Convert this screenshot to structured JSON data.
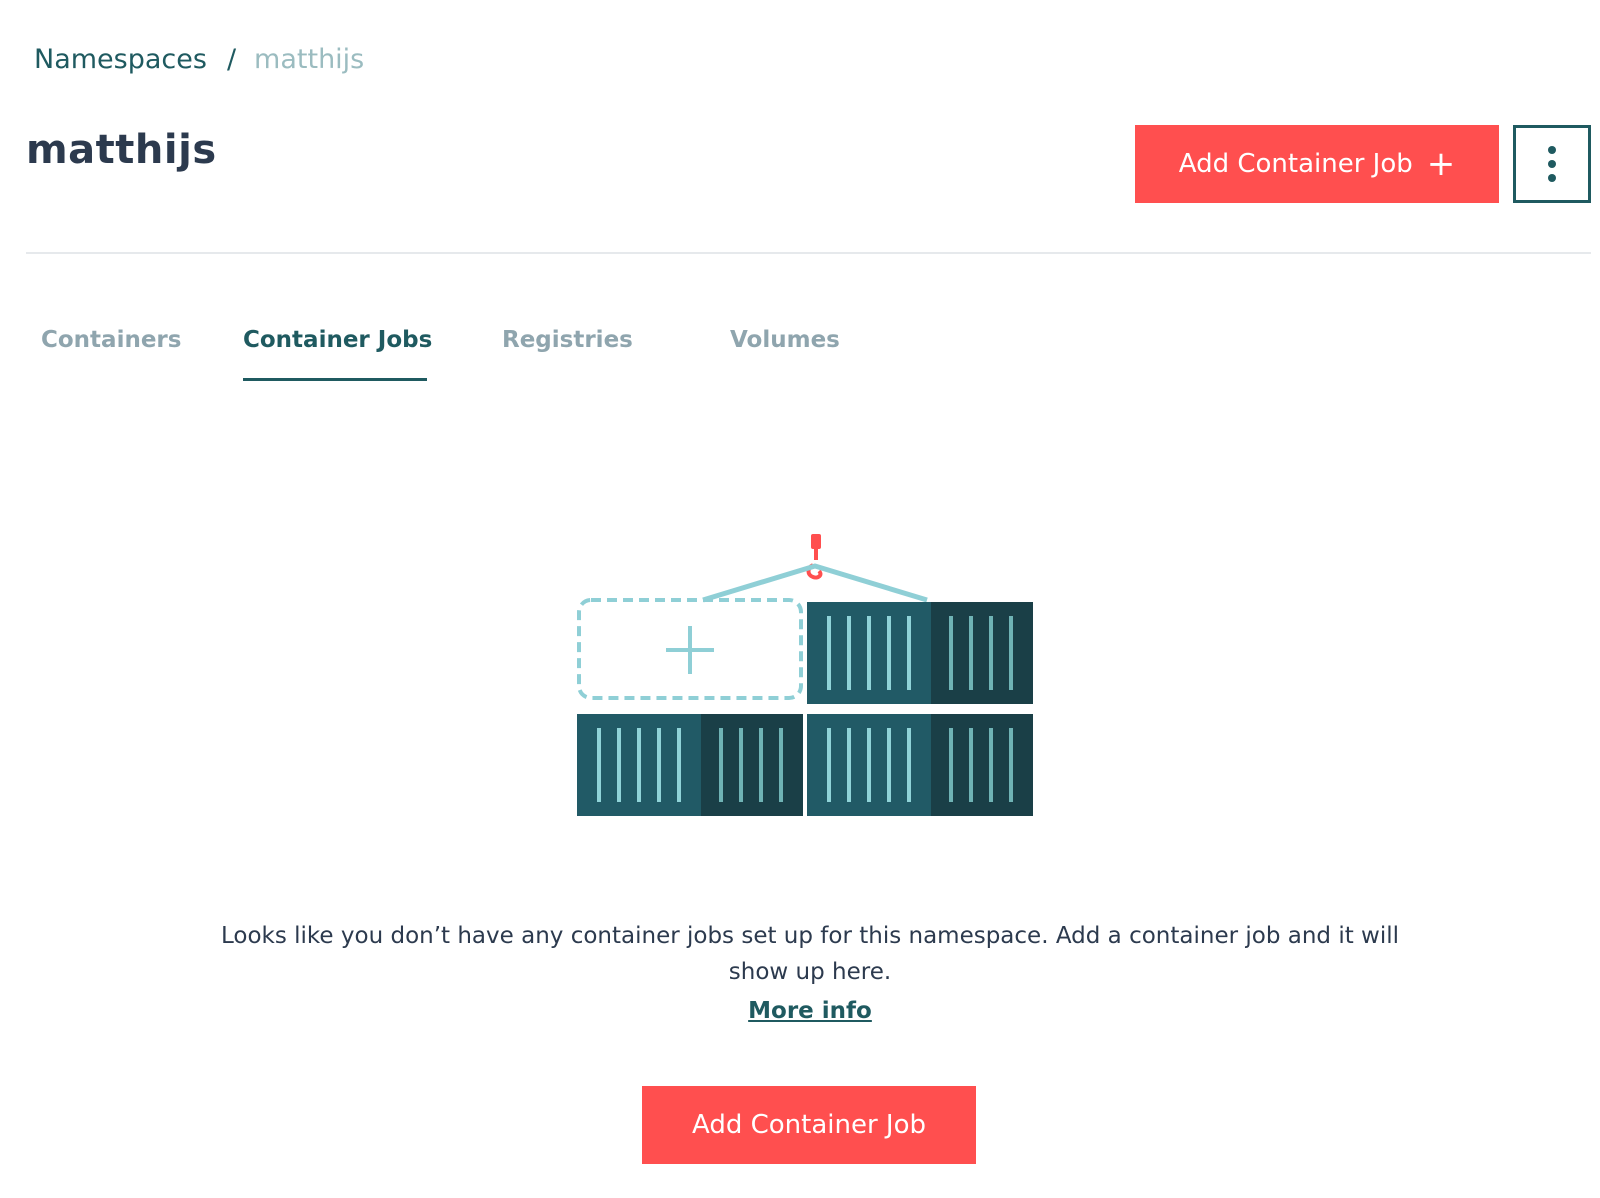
{
  "breadcrumb": {
    "root": "Namespaces",
    "separator": "/",
    "current": "matthijs"
  },
  "header": {
    "title": "matthijs",
    "add_button_label": "Add Container Job",
    "add_button_icon": "plus-icon",
    "more_menu_icon": "vertical-ellipsis-icon"
  },
  "tabs": [
    {
      "label": "Containers",
      "active": false
    },
    {
      "label": "Container Jobs",
      "active": true
    },
    {
      "label": "Registries",
      "active": false
    },
    {
      "label": "Volumes",
      "active": false
    }
  ],
  "empty_state": {
    "illustration": "shipping-containers-crane-illustration",
    "message": "Looks like you don’t have any container jobs set up for this namespace. Add a container job and it will show up here.",
    "link_label": "More info",
    "button_label": "Add Container Job"
  },
  "colors": {
    "accent": "#ff4f4f",
    "primary": "#1f5a60",
    "container_dark": "#1a3f47",
    "container_main": "#215a66",
    "container_stripe": "#8fd3d8",
    "tab_inactive": "#8fa5ae"
  }
}
